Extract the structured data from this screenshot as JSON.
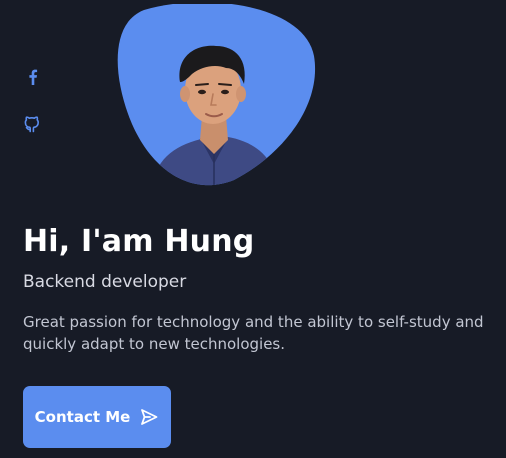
{
  "social": {
    "items": [
      {
        "icon": "facebook-icon"
      },
      {
        "icon": "github-icon"
      }
    ]
  },
  "profile": {
    "avatar_bg_color": "#5b8def"
  },
  "hero": {
    "title": "Hi, I'am Hung",
    "subtitle": "Backend developer",
    "description": "Great passion for technology and the ability to self-study and quickly adapt to new technologies.",
    "cta_label": "Contact Me",
    "cta_icon": "send-icon"
  },
  "colors": {
    "background": "#171b26",
    "accent": "#5b8def",
    "text_primary": "#ffffff",
    "text_secondary": "#c2c6d2"
  }
}
